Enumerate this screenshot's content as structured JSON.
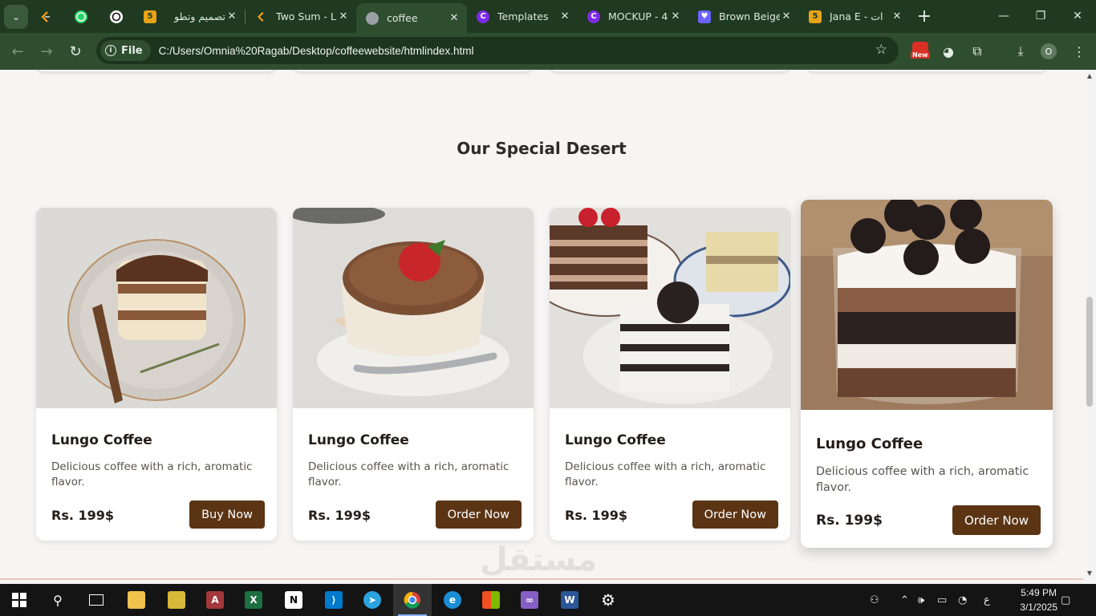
{
  "browser": {
    "tabs": [
      {
        "title": "تصميم وتطو",
        "favicon": "5",
        "favicon_color": "#e8a317",
        "active": false
      },
      {
        "title": "Two Sum - L",
        "favicon": "",
        "favicon_color": "#ffa116",
        "active": false
      },
      {
        "title": "coffee",
        "favicon": "",
        "favicon_color": "#9aa0a6",
        "active": true
      },
      {
        "title": "Templates",
        "favicon": "C",
        "favicon_color": "#7d2ae8",
        "active": false
      },
      {
        "title": "MOCKUP - 4",
        "favicon": "C",
        "favicon_color": "#7d2ae8",
        "active": false
      },
      {
        "title": "Brown Beige",
        "favicon": "",
        "favicon_color": "#6c63ff",
        "active": false
      },
      {
        "title": "Jana E - ات",
        "favicon": "5",
        "favicon_color": "#e8a317",
        "active": false
      }
    ],
    "url_chip": "File",
    "url": "C:/Users/Omnia%20Ragab/Desktop/coffeewebsite/htmlindex.html",
    "badge_new": "New",
    "profile_initial": "O"
  },
  "section": {
    "title": "Our Special Desert"
  },
  "cards": [
    {
      "title": "Lungo Coffee",
      "description": "Delicious coffee with a rich, aromatic flavor.",
      "price": "Rs. 199$",
      "button": "Buy Now"
    },
    {
      "title": "Lungo Coffee",
      "description": "Delicious coffee with a rich, aromatic flavor.",
      "price": "Rs. 199$",
      "button": "Order Now"
    },
    {
      "title": "Lungo Coffee",
      "description": "Delicious coffee with a rich, aromatic flavor.",
      "price": "Rs. 199$",
      "button": "Order Now"
    },
    {
      "title": "Lungo Coffee",
      "description": "Delicious coffee with a rich, aromatic flavor.",
      "price": "Rs. 199$",
      "button": "Order Now"
    }
  ],
  "watermark": "مستقل",
  "taskbar": {
    "time": "5:49 PM",
    "date": "3/1/2025",
    "lang": "ع"
  },
  "colors": {
    "button_brown": "#5b3414",
    "chrome_green": "#2f4e30",
    "page_bg": "#f6f5f4"
  }
}
